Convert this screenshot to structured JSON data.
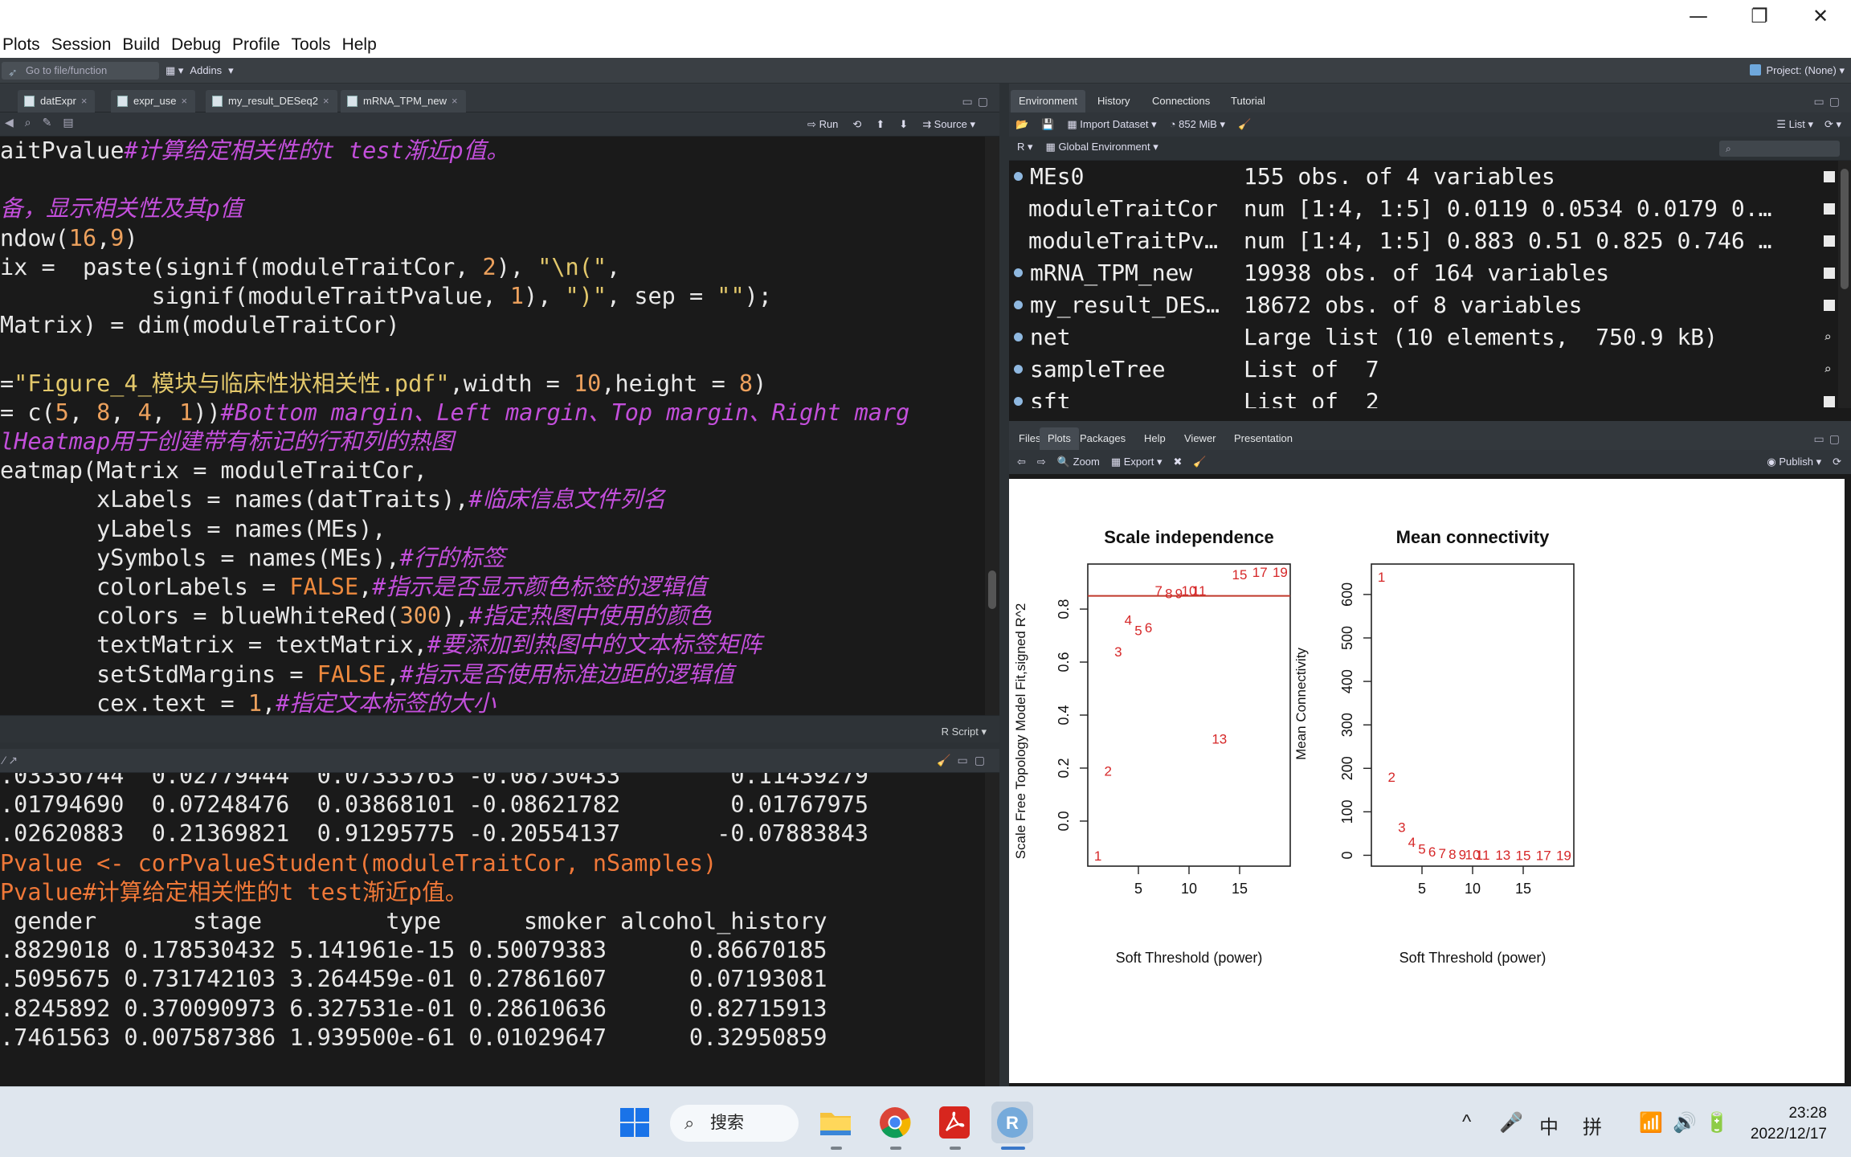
{
  "window": {
    "minimize": "—",
    "restore": "❐",
    "close": "✕"
  },
  "menu": [
    "Plots",
    "Session",
    "Build",
    "Debug",
    "Profile",
    "Tools",
    "Help"
  ],
  "globalbar": {
    "goto_placeholder": "Go to file/function",
    "addins": "Addins",
    "project": "Project: (None)"
  },
  "source": {
    "tabs": [
      "datExpr",
      "expr_use",
      "my_result_DESeq2",
      "mRNA_TPM_new"
    ],
    "toolbar": {
      "run": "Run",
      "source": "Source"
    },
    "lines": [
      [
        {
          "t": "aitPvalue",
          "c": ""
        },
        {
          "t": "#计算给定相关性的t test渐近p值。",
          "c": "cm"
        }
      ],
      [],
      [
        {
          "t": "备，显示相关性及其p值",
          "c": "cm"
        }
      ],
      [
        {
          "t": "ndow(",
          "c": ""
        },
        {
          "t": "16",
          "c": "nm"
        },
        {
          "t": ",",
          "c": ""
        },
        {
          "t": "9",
          "c": "nm"
        },
        {
          "t": ")",
          "c": ""
        }
      ],
      [
        {
          "t": "ix =  paste(signif(moduleTraitCor, ",
          "c": ""
        },
        {
          "t": "2",
          "c": "nm"
        },
        {
          "t": "), ",
          "c": ""
        },
        {
          "t": "\"\\n(\"",
          "c": "st"
        },
        {
          "t": ",",
          "c": ""
        }
      ],
      [
        {
          "t": "           signif(moduleTraitPvalue, ",
          "c": ""
        },
        {
          "t": "1",
          "c": "nm"
        },
        {
          "t": "), ",
          "c": ""
        },
        {
          "t": "\")\"",
          "c": "st"
        },
        {
          "t": ", sep = ",
          "c": ""
        },
        {
          "t": "\"\"",
          "c": "st"
        },
        {
          "t": ");",
          "c": ""
        }
      ],
      [
        {
          "t": "Matrix) = dim(moduleTraitCor)",
          "c": ""
        }
      ],
      [],
      [
        {
          "t": "=",
          "c": ""
        },
        {
          "t": "\"Figure_4_模块与临床性状相关性.pdf\"",
          "c": "st"
        },
        {
          "t": ",width = ",
          "c": ""
        },
        {
          "t": "10",
          "c": "nm"
        },
        {
          "t": ",height = ",
          "c": ""
        },
        {
          "t": "8",
          "c": "nm"
        },
        {
          "t": ")",
          "c": ""
        }
      ],
      [
        {
          "t": "= c(",
          "c": ""
        },
        {
          "t": "5",
          "c": "nm"
        },
        {
          "t": ", ",
          "c": ""
        },
        {
          "t": "8",
          "c": "nm"
        },
        {
          "t": ", ",
          "c": ""
        },
        {
          "t": "4",
          "c": "nm"
        },
        {
          "t": ", ",
          "c": ""
        },
        {
          "t": "1",
          "c": "nm"
        },
        {
          "t": "))",
          "c": ""
        },
        {
          "t": "#Bottom margin、Left margin、Top margin、Right marg",
          "c": "cm"
        }
      ],
      [
        {
          "t": "lHeatmap用于创建带有标记的行和列的热图",
          "c": "cm"
        }
      ],
      [
        {
          "t": "eatmap(Matrix = moduleTraitCor,",
          "c": ""
        }
      ],
      [
        {
          "t": "       xLabels = names(datTraits),",
          "c": ""
        },
        {
          "t": "#临床信息文件列名",
          "c": "cm"
        }
      ],
      [
        {
          "t": "       yLabels = names(MEs),",
          "c": ""
        }
      ],
      [
        {
          "t": "       ySymbols = names(MEs),",
          "c": ""
        },
        {
          "t": "#行的标签",
          "c": "cm"
        }
      ],
      [
        {
          "t": "       colorLabels = ",
          "c": ""
        },
        {
          "t": "FALSE",
          "c": "kw"
        },
        {
          "t": ",",
          "c": ""
        },
        {
          "t": "#指示是否显示颜色标签的逻辑值",
          "c": "cm"
        }
      ],
      [
        {
          "t": "       colors = blueWhiteRed(",
          "c": ""
        },
        {
          "t": "300",
          "c": "nm"
        },
        {
          "t": "),",
          "c": ""
        },
        {
          "t": "#指定热图中使用的颜色",
          "c": "cm"
        }
      ],
      [
        {
          "t": "       textMatrix = textMatrix,",
          "c": ""
        },
        {
          "t": "#要添加到热图中的文本标签矩阵",
          "c": "cm"
        }
      ],
      [
        {
          "t": "       setStdMargins = ",
          "c": ""
        },
        {
          "t": "FALSE",
          "c": "kw"
        },
        {
          "t": ",",
          "c": ""
        },
        {
          "t": "#指示是否使用标准边距的逻辑值",
          "c": "cm"
        }
      ],
      [
        {
          "t": "       cex.text = ",
          "c": ""
        },
        {
          "t": "1",
          "c": "nm"
        },
        {
          "t": ",",
          "c": ""
        },
        {
          "t": "#指定文本标签的大小",
          "c": "cm"
        }
      ]
    ],
    "status": "R Script"
  },
  "console": {
    "lines": [
      [
        {
          "t": ".03336744  0.02779444  0.07333763 -0.08730433        0.11439279",
          "c": ""
        }
      ],
      [
        {
          "t": ".01794690  0.07248476  0.03868101 -0.08621782        0.01767975",
          "c": ""
        }
      ],
      [
        {
          "t": ".02620883  0.21369821  0.91295775 -0.20554137       -0.07883843",
          "c": ""
        }
      ],
      [
        {
          "t": "Pvalue <- corPvalueStudent(moduleTraitCor, nSamples)",
          "c": "cin"
        }
      ],
      [
        {
          "t": "Pvalue#计算给定相关性的t test渐近p值。",
          "c": "cin"
        }
      ],
      [
        {
          "t": " gender       stage         type      smoker alcohol_history",
          "c": ""
        }
      ],
      [
        {
          "t": ".8829018 0.178530432 5.141961e-15 0.50079383      0.86670185",
          "c": ""
        }
      ],
      [
        {
          "t": ".5095675 0.731742103 3.264459e-01 0.27861607      0.07193081",
          "c": ""
        }
      ],
      [
        {
          "t": ".8245892 0.370090973 6.327531e-01 0.28610636      0.82715913",
          "c": ""
        }
      ],
      [
        {
          "t": ".7461563 0.007587386 1.939500e-61 0.01029647      0.32950859",
          "c": ""
        }
      ]
    ]
  },
  "env": {
    "tabs": [
      "Environment",
      "History",
      "Connections",
      "Tutorial"
    ],
    "toolbar": {
      "import": "Import Dataset",
      "memory": "852 MiB",
      "view": "List"
    },
    "scope": {
      "lang": "R",
      "env": "Global Environment"
    },
    "rows": [
      {
        "name": "MEs0",
        "value": "155 obs. of 4 variables",
        "dot": true,
        "act": "grid"
      },
      {
        "name": "moduleTraitCor",
        "value": "num [1:4, 1:5] 0.0119 0.0534 0.0179 0.…",
        "dot": false,
        "act": "grid"
      },
      {
        "name": "moduleTraitPv…",
        "value": "num [1:4, 1:5] 0.883 0.51 0.825 0.746 …",
        "dot": false,
        "act": "grid"
      },
      {
        "name": "mRNA_TPM_new",
        "value": "19938 obs. of 164 variables",
        "dot": true,
        "act": "grid"
      },
      {
        "name": "my_result_DES…",
        "value": "18672 obs. of 8 variables",
        "dot": true,
        "act": "grid"
      },
      {
        "name": "net",
        "value": "Large list (10 elements,  750.9 kB)",
        "dot": true,
        "act": "mag"
      },
      {
        "name": "sampleTree",
        "value": "List of  7",
        "dot": true,
        "act": "mag"
      },
      {
        "name": "sft",
        "value": "List of  2",
        "dot": true,
        "act": "grid"
      }
    ]
  },
  "plots": {
    "tabs": [
      "Files",
      "Plots",
      "Packages",
      "Help",
      "Viewer",
      "Presentation"
    ],
    "toolbar": {
      "zoom": "Zoom",
      "export": "Export",
      "publish": "Publish"
    }
  },
  "chart_data": [
    {
      "type": "scatter",
      "title": "Scale independence",
      "xlabel": "Soft Threshold (power)",
      "ylabel": "Scale Free Topology Model Fit,signed R^2",
      "x": [
        1,
        2,
        3,
        4,
        5,
        6,
        7,
        8,
        9,
        10,
        11,
        13,
        15,
        17,
        19
      ],
      "y": [
        -0.13,
        0.19,
        0.64,
        0.76,
        0.72,
        0.73,
        0.87,
        0.86,
        0.86,
        0.87,
        0.87,
        0.31,
        0.93,
        0.94,
        0.94
      ],
      "point_labels": [
        "1",
        "2",
        "3",
        "4",
        "5",
        "6",
        "7",
        "8",
        "9",
        "10",
        "11",
        "13",
        "15",
        "17",
        "19"
      ],
      "xticks": [
        5,
        10,
        15
      ],
      "yticks": [
        "0.0",
        "0.2",
        "0.4",
        "0.6",
        "0.8"
      ],
      "xlim": [
        0,
        20
      ],
      "ylim": [
        -0.17,
        0.97
      ],
      "hline": 0.85,
      "color": "#d62728"
    },
    {
      "type": "scatter",
      "title": "Mean connectivity",
      "xlabel": "Soft Threshold (power)",
      "ylabel": "Mean Connectivity",
      "x": [
        1,
        2,
        3,
        4,
        5,
        6,
        7,
        8,
        9,
        10,
        11,
        13,
        15,
        17,
        19
      ],
      "y": [
        640,
        180,
        65,
        30,
        15,
        8,
        5,
        3,
        2,
        1.5,
        1,
        0.5,
        0.3,
        0.2,
        0.1
      ],
      "point_labels": [
        "1",
        "2",
        "3",
        "4",
        "5",
        "6",
        "7",
        "8",
        "9",
        "10",
        "11",
        "13",
        "15",
        "17",
        "19"
      ],
      "xticks": [
        5,
        10,
        15
      ],
      "yticks": [
        "0",
        "100",
        "200",
        "300",
        "400",
        "500",
        "600"
      ],
      "xlim": [
        0,
        20
      ],
      "ylim": [
        -25,
        670
      ],
      "color": "#d62728"
    }
  ],
  "taskbar": {
    "search": "搜索",
    "tray": [
      "^",
      "🎤",
      "中",
      "拼",
      "📶",
      "🔊",
      "🔋"
    ],
    "time": "23:28",
    "date": "2022/12/17"
  }
}
